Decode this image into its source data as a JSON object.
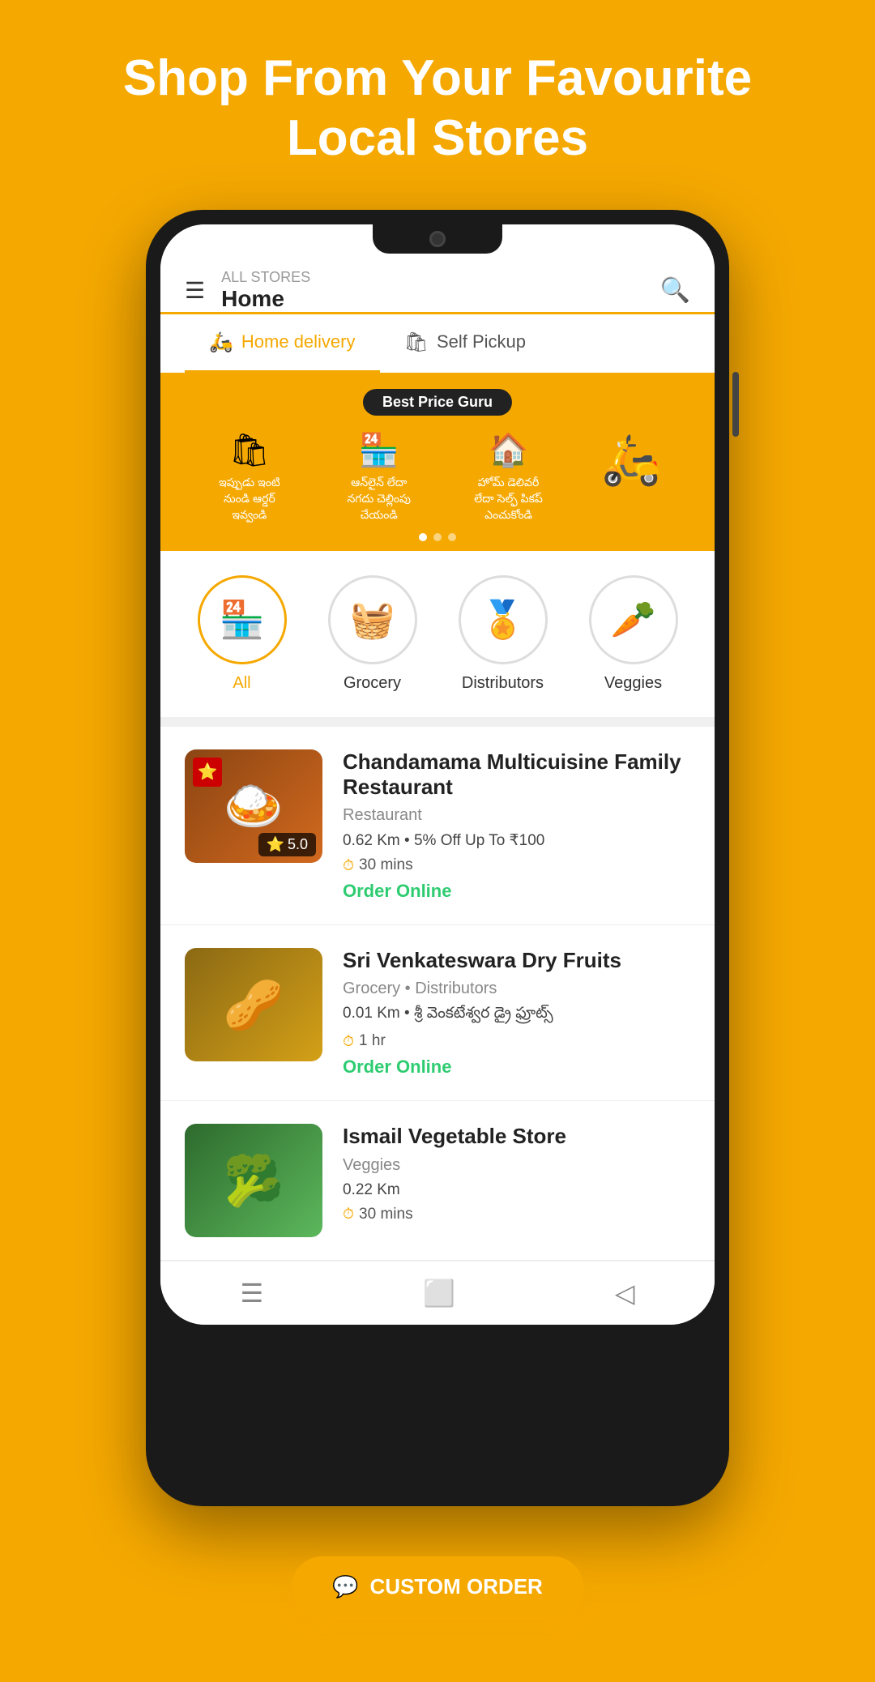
{
  "hero": {
    "title": "Shop From Your Favourite Local Stores"
  },
  "header": {
    "all_stores_label": "ALL STORES",
    "home_label": "Home"
  },
  "tabs": [
    {
      "id": "home-delivery",
      "label": "Home delivery",
      "icon": "🛵",
      "active": true
    },
    {
      "id": "self-pickup",
      "label": "Self Pickup",
      "icon": "🛍",
      "active": false
    }
  ],
  "banner": {
    "brand": "Best Price Guru",
    "steps": [
      {
        "icon": "🛍",
        "line1": "ఇప్పుడు ఇంటి",
        "line2": "నుండి ఆర్డర్ ఇవ్వండి"
      },
      {
        "icon": "🏪",
        "line1": "ఆన్‌లైన్ లేదా",
        "line2": "నగదు చెల్లింపు చేయండి"
      },
      {
        "icon": "🏠",
        "line1": "హోమ్ డెలివరీ",
        "line2": "లేదా సెల్ఫ్ పికప్ ఎంచుకోండి"
      }
    ],
    "dots": [
      true,
      false,
      false
    ]
  },
  "categories": [
    {
      "id": "all",
      "label": "All",
      "icon": "🏪",
      "active": true
    },
    {
      "id": "grocery",
      "label": "Grocery",
      "icon": "🧺",
      "active": false
    },
    {
      "id": "distributors",
      "label": "Distributors",
      "icon": "🏅",
      "active": false
    },
    {
      "id": "veggies",
      "label": "Veggies",
      "icon": "🥕",
      "active": false
    }
  ],
  "stores": [
    {
      "name": "Chandamama Multicuisine Family Restaurant",
      "type": "Restaurant",
      "distance": "0.62 Km",
      "offer": "5% Off Up To ₹100",
      "time": "30 mins",
      "action": "Order Online",
      "rating": "5.0",
      "img_emoji": "🍛",
      "img_class": "store-img-biryani",
      "has_badge": true
    },
    {
      "name": "Sri Venkateswara Dry Fruits",
      "type": "Grocery • Distributors",
      "distance": "0.01 Km",
      "offer": "• శ్రీ వెంకటేశ్వర డ్రై ఫ్రూట్స్",
      "time": "1 hr",
      "action": "Order Online",
      "rating": "",
      "img_emoji": "🥜",
      "img_class": "store-img-dryfruits",
      "has_badge": false
    },
    {
      "name": "Ismail Vegetable Store",
      "type": "Veggies",
      "distance": "0.22 Km",
      "offer": "",
      "time": "30 mins",
      "action": "",
      "rating": "",
      "img_emoji": "🥦",
      "img_class": "store-img-veggies",
      "has_badge": false
    }
  ],
  "custom_order": {
    "label": "CUSTOM ORDER",
    "icon": "💬"
  },
  "bottom_nav": {
    "items": [
      "☰",
      "⬜",
      "◁"
    ]
  }
}
